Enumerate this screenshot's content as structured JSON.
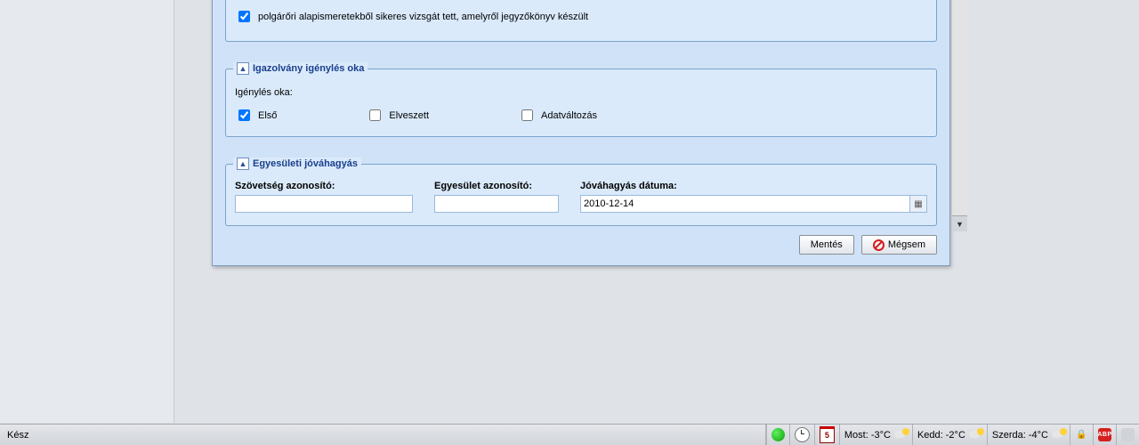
{
  "top_checkbox": {
    "label": "polgárőri alapismeretekből sikeres vizsgát tett, amelyről jegyzőkönyv készült",
    "checked": true
  },
  "reason_section": {
    "title": "Igazolvány igénylés oka",
    "prompt": "Igénylés oka:",
    "options": [
      {
        "label": "Első",
        "checked": true
      },
      {
        "label": "Elveszett",
        "checked": false
      },
      {
        "label": "Adatváltozás",
        "checked": false
      }
    ]
  },
  "approval": {
    "title": "Egyesületi jóváhagyás",
    "federation_label": "Szövetség azonosító:",
    "federation_value": "",
    "club_label": "Egyesület azonosító:",
    "club_value": "",
    "date_label": "Jóváhagyás dátuma:",
    "date_value": "2010-12-14"
  },
  "actions": {
    "save": "Mentés",
    "cancel": "Mégsem"
  },
  "statusbar": {
    "ready": "Kész",
    "calendar_day": "5",
    "now": "Most: -3°C",
    "tue": "Kedd: -2°C",
    "wed": "Szerda: -4°C",
    "abp": "ABP"
  }
}
